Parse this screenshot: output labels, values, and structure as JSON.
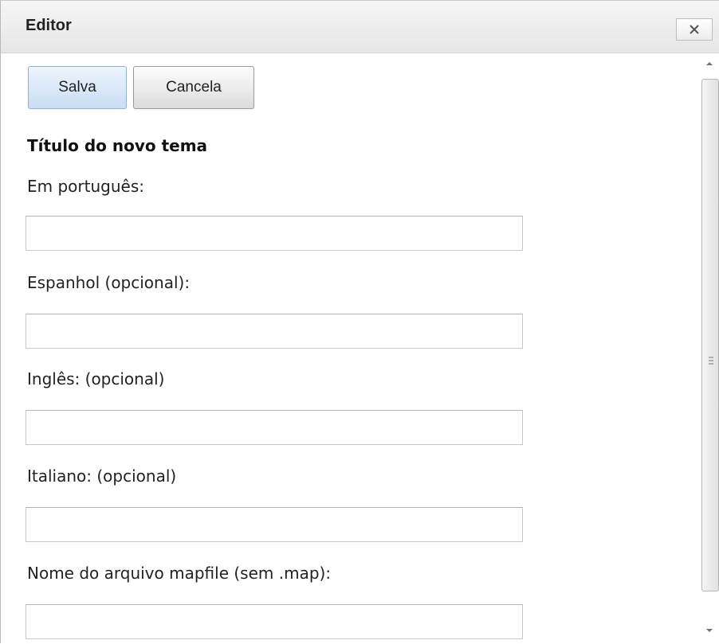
{
  "window": {
    "title": "Editor",
    "close_icon": "close-icon"
  },
  "toolbar": {
    "save_label": "Salva",
    "cancel_label": "Cancela"
  },
  "form": {
    "section_title": "Título do novo tema",
    "fields": [
      {
        "label": "Em português:",
        "value": ""
      },
      {
        "label": "Espanhol (opcional):",
        "value": ""
      },
      {
        "label": "Inglês: (opcional)",
        "value": ""
      },
      {
        "label": "Italiano: (opcional)",
        "value": ""
      },
      {
        "label": "Nome do arquivo mapfile (sem .map):",
        "value": ""
      }
    ]
  },
  "scrollbar": {
    "up_icon": "chevron-up-icon",
    "down_icon": "chevron-down-icon",
    "grip_icon": "grip-icon"
  }
}
